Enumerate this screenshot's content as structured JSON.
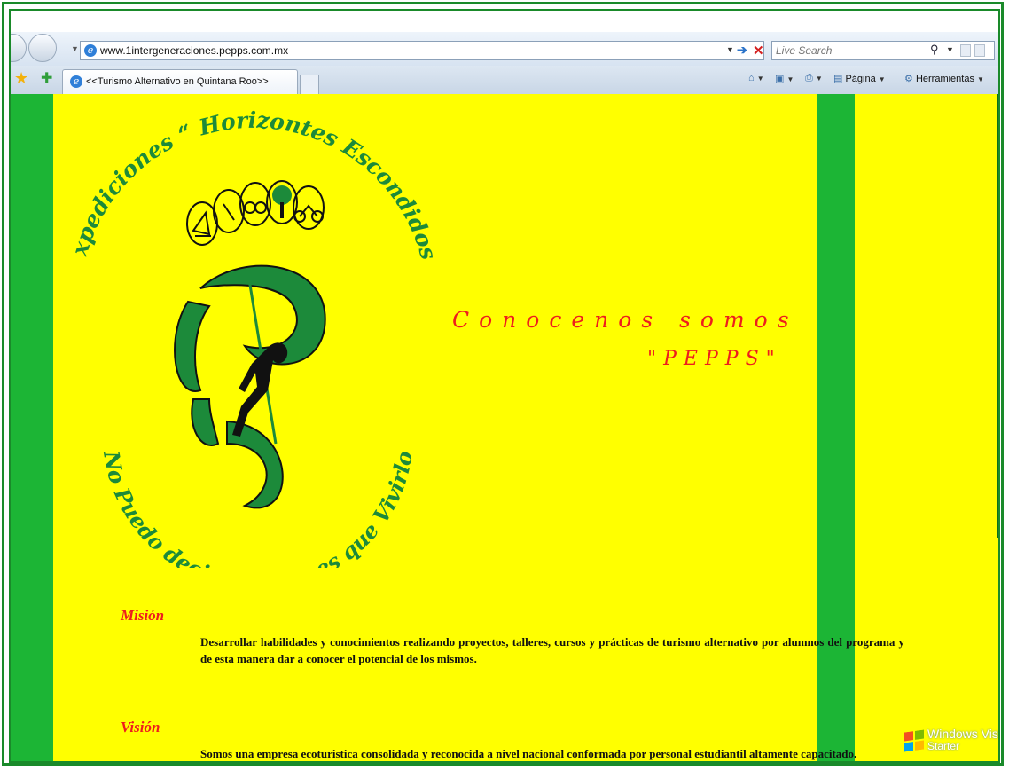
{
  "browser": {
    "address": "www.1intergeneraciones.pepps.com.mx",
    "search_placeholder": "Live Search",
    "tab_title": "<<Turismo Alternativo en Quintana Roo>>",
    "toolbar": {
      "page_label": "Página",
      "tools_label": "Herramientas"
    }
  },
  "logo": {
    "top_text": "Expediciones “ Horizontes Escondidos”",
    "bottom_text": "No Puedo decirte... Tienes que Vivirlo"
  },
  "hero": {
    "line1": "Conocenos somos",
    "line2": "\"PEPPS\""
  },
  "mision": {
    "title": "Misión",
    "body": "Desarrollar habilidades y conocimientos realizando proyectos, talleres, cursos y prácticas de turismo alternativo por alumnos del programa y de esta manera dar a conocer el potencial de los mismos."
  },
  "vision": {
    "title": "Visión",
    "body": "Somos una empresa ecoturistica consolidada y reconocida a nivel nacional conformada por personal estudiantil altamente capacitado."
  },
  "watermark": {
    "line1": "Windows Vista",
    "line2": "Starter"
  },
  "colors": {
    "page_bg": "#ffff00",
    "stripe": "#1cb535",
    "logo_green": "#1c8a3a",
    "title_red": "#ee1d1d",
    "frame": "#1a8a2a"
  }
}
